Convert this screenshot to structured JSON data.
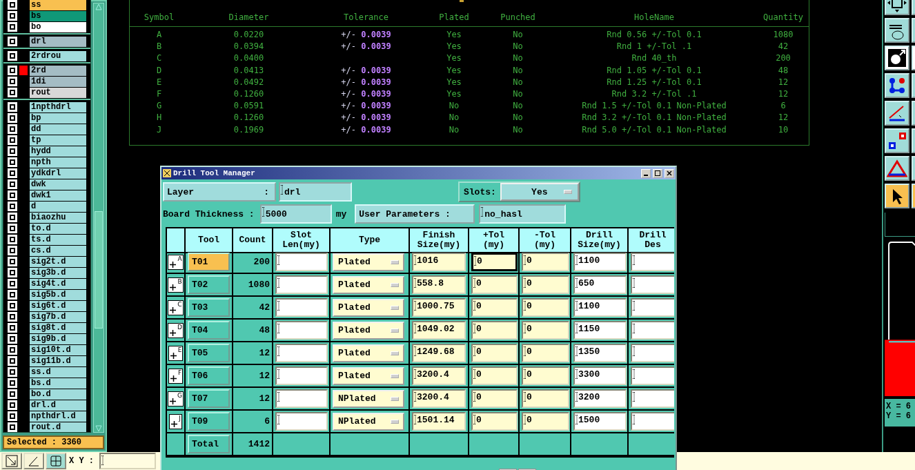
{
  "layers_panel": {
    "groups": [
      {
        "items": [
          {
            "name": "ss",
            "color": "#f8c050"
          },
          {
            "name": "bs",
            "color": "#109878"
          },
          {
            "name": "bo",
            "color": "#ffffff"
          }
        ]
      },
      {
        "items": [
          {
            "name": "drl",
            "color": "#a4bcc4"
          }
        ]
      },
      {
        "items": [
          {
            "name": "2rdrou",
            "color": "#a0dcdc"
          }
        ]
      },
      {
        "items": [
          {
            "name": "2rd",
            "color": "#a4bcc4",
            "swatch": {
              "color": "#ff0000"
            }
          },
          {
            "name": "1di",
            "color": "#a4bcc4"
          },
          {
            "name": "rout",
            "color": "#d8d8d8"
          }
        ]
      },
      {
        "items": [
          {
            "name": "1npthdrl",
            "color": "#a0dcdc"
          },
          {
            "name": "bp",
            "color": "#a0dcdc"
          },
          {
            "name": "dd",
            "color": "#a0dcdc"
          },
          {
            "name": "tp",
            "color": "#a0dcdc"
          },
          {
            "name": "hydd",
            "color": "#a0dcdc"
          },
          {
            "name": "npth",
            "color": "#a0dcdc"
          },
          {
            "name": "ydkdrl",
            "color": "#a0dcdc"
          },
          {
            "name": "dwk",
            "color": "#a0dcdc"
          },
          {
            "name": "dwk1",
            "color": "#a0dcdc"
          },
          {
            "name": "d",
            "color": "#a0dcdc"
          },
          {
            "name": "biaozhu",
            "color": "#a0dcdc"
          },
          {
            "name": "to.d",
            "color": "#a0dcdc"
          },
          {
            "name": "ts.d",
            "color": "#a0dcdc"
          },
          {
            "name": "cs.d",
            "color": "#a0dcdc"
          },
          {
            "name": "sig2t.d",
            "color": "#a0dcdc"
          },
          {
            "name": "sig3b.d",
            "color": "#a0dcdc"
          },
          {
            "name": "sig4t.d",
            "color": "#a0dcdc"
          },
          {
            "name": "sig5b.d",
            "color": "#a0dcdc"
          },
          {
            "name": "sig6t.d",
            "color": "#a0dcdc"
          },
          {
            "name": "sig7b.d",
            "color": "#a0dcdc"
          },
          {
            "name": "sig8t.d",
            "color": "#a0dcdc"
          },
          {
            "name": "sig9b.d",
            "color": "#a0dcdc"
          },
          {
            "name": "sig10t.d",
            "color": "#a0dcdc"
          },
          {
            "name": "sig11b.d",
            "color": "#a0dcdc"
          },
          {
            "name": "ss.d",
            "color": "#a0dcdc"
          },
          {
            "name": "bs.d",
            "color": "#a0dcdc"
          },
          {
            "name": "bo.d",
            "color": "#a0dcdc"
          },
          {
            "name": "drl.d",
            "color": "#a0dcdc"
          },
          {
            "name": "npthdrl.d",
            "color": "#a0dcdc"
          },
          {
            "name": "rout.d",
            "color": "#a0dcdc"
          }
        ]
      }
    ],
    "selected": "Selected : 3360"
  },
  "hole_table": {
    "columns": [
      "Symbol",
      "Diameter",
      "Tolerance",
      "Plated",
      "Punched",
      "HoleName",
      "Quantity"
    ],
    "rows": [
      {
        "symbol": "A",
        "diameter": "0.0220",
        "tolerance": {
          "sign": "+/-",
          "value": "0.0039"
        },
        "plated": "Yes",
        "punched": "No",
        "hole_name": "Rnd 0.56 +/-Tol 0.1",
        "quantity": "1080"
      },
      {
        "symbol": "B",
        "diameter": "0.0394",
        "tolerance": {
          "sign": "+/-",
          "value": "0.0039"
        },
        "plated": "Yes",
        "punched": "No",
        "hole_name": "Rnd 1 +/-Tol .1",
        "quantity": "42"
      },
      {
        "symbol": "C",
        "diameter": "0.0400",
        "plated": "Yes",
        "punched": "No",
        "hole_name": "Rnd 40_th",
        "quantity": "200"
      },
      {
        "symbol": "D",
        "diameter": "0.0413",
        "tolerance": {
          "sign": "+/-",
          "value": "0.0039"
        },
        "plated": "Yes",
        "punched": "No",
        "hole_name": "Rnd 1.05 +/-Tol 0.1",
        "quantity": "48"
      },
      {
        "symbol": "E",
        "diameter": "0.0492",
        "tolerance": {
          "sign": "+/-",
          "value": "0.0039"
        },
        "plated": "Yes",
        "punched": "No",
        "hole_name": "Rnd 1.25 +/-Tol 0.1",
        "quantity": "12"
      },
      {
        "symbol": "F",
        "diameter": "0.1260",
        "tolerance": {
          "sign": "+/-",
          "value": "0.0039"
        },
        "plated": "Yes",
        "punched": "No",
        "hole_name": "Rnd 3.2 +/-Tol .1",
        "quantity": "12"
      },
      {
        "symbol": "G",
        "diameter": "0.0591",
        "tolerance": {
          "sign": "+/-",
          "value": "0.0039"
        },
        "plated": "No",
        "punched": "No",
        "hole_name": "Rnd 1.5 +/-Tol 0.1 Non-Plated",
        "quantity": "6"
      },
      {
        "symbol": "H",
        "diameter": "0.1260",
        "tolerance": {
          "sign": "+/-",
          "value": "0.0039"
        },
        "plated": "No",
        "punched": "No",
        "hole_name": "Rnd 3.2 +/-Tol 0.1 Non-Plated",
        "quantity": "12"
      },
      {
        "symbol": "J",
        "diameter": "0.1969",
        "tolerance": {
          "sign": "+/-",
          "value": "0.0039"
        },
        "plated": "No",
        "punched": "No",
        "hole_name": "Rnd 5.0 +/-Tol 0.1 Non-Plated",
        "quantity": "10"
      }
    ]
  },
  "dialog": {
    "title": "Drill Tool Manager",
    "layer_label": "Layer",
    "layer_separator": ":",
    "layer_value": "drl",
    "slots_label": "Slots:",
    "slots_value": "Yes",
    "board_thickness_label": "Board Thickness :",
    "board_thickness_value": "5000",
    "unit": "my",
    "user_parameters_label": "User Parameters :",
    "user_parameters_value": "no_hasl",
    "columns": [
      "Tool",
      "Count",
      "Slot Len(my)",
      "Type",
      "Finish Size(my)",
      "+Tol (my)",
      "-Tol (my)",
      "Drill Size(my)",
      "Drill Des"
    ],
    "rows": [
      {
        "symbol": "A",
        "tool": "T01",
        "selected": true,
        "count": "200",
        "type": "Plated",
        "finish": "1016",
        "plus_tol": "0",
        "plus_tol_focused": true,
        "minus_tol": "0",
        "drill_size": "1100"
      },
      {
        "symbol": "B",
        "tool": "T02",
        "selected": false,
        "count": "1080",
        "type": "Plated",
        "finish": "558.8",
        "plus_tol": "0",
        "plus_tol_focused": false,
        "minus_tol": "0",
        "drill_size": "650"
      },
      {
        "symbol": "C",
        "tool": "T03",
        "selected": false,
        "count": "42",
        "type": "Plated",
        "finish": "1000.75",
        "plus_tol": "0",
        "plus_tol_focused": false,
        "minus_tol": "0",
        "drill_size": "1100"
      },
      {
        "symbol": "D",
        "tool": "T04",
        "selected": false,
        "count": "48",
        "type": "Plated",
        "finish": "1049.02",
        "plus_tol": "0",
        "plus_tol_focused": false,
        "minus_tol": "0",
        "drill_size": "1150"
      },
      {
        "symbol": "E",
        "tool": "T05",
        "selected": false,
        "count": "12",
        "type": "Plated",
        "finish": "1249.68",
        "plus_tol": "0",
        "plus_tol_focused": false,
        "minus_tol": "0",
        "drill_size": "1350"
      },
      {
        "symbol": "F",
        "tool": "T06",
        "selected": false,
        "count": "12",
        "type": "Plated",
        "finish": "3200.4",
        "plus_tol": "0",
        "plus_tol_focused": false,
        "minus_tol": "0",
        "drill_size": "3300"
      },
      {
        "symbol": "G",
        "tool": "T07",
        "selected": false,
        "count": "12",
        "type": "NPlated",
        "finish": "3200.4",
        "plus_tol": "0",
        "plus_tol_focused": false,
        "minus_tol": "0",
        "drill_size": "3200"
      },
      {
        "symbol": "J",
        "tool": "T09",
        "selected": false,
        "count": "6",
        "type": "NPlated",
        "finish": "1501.14",
        "plus_tol": "0",
        "plus_tol_focused": false,
        "minus_tol": "0",
        "drill_size": "1500"
      }
    ],
    "total": {
      "label": "Total",
      "count": "1412"
    }
  },
  "status_bar": {
    "xy_label": "X Y :"
  },
  "coordinates": [
    "X = 6",
    "Y = 6"
  ]
}
